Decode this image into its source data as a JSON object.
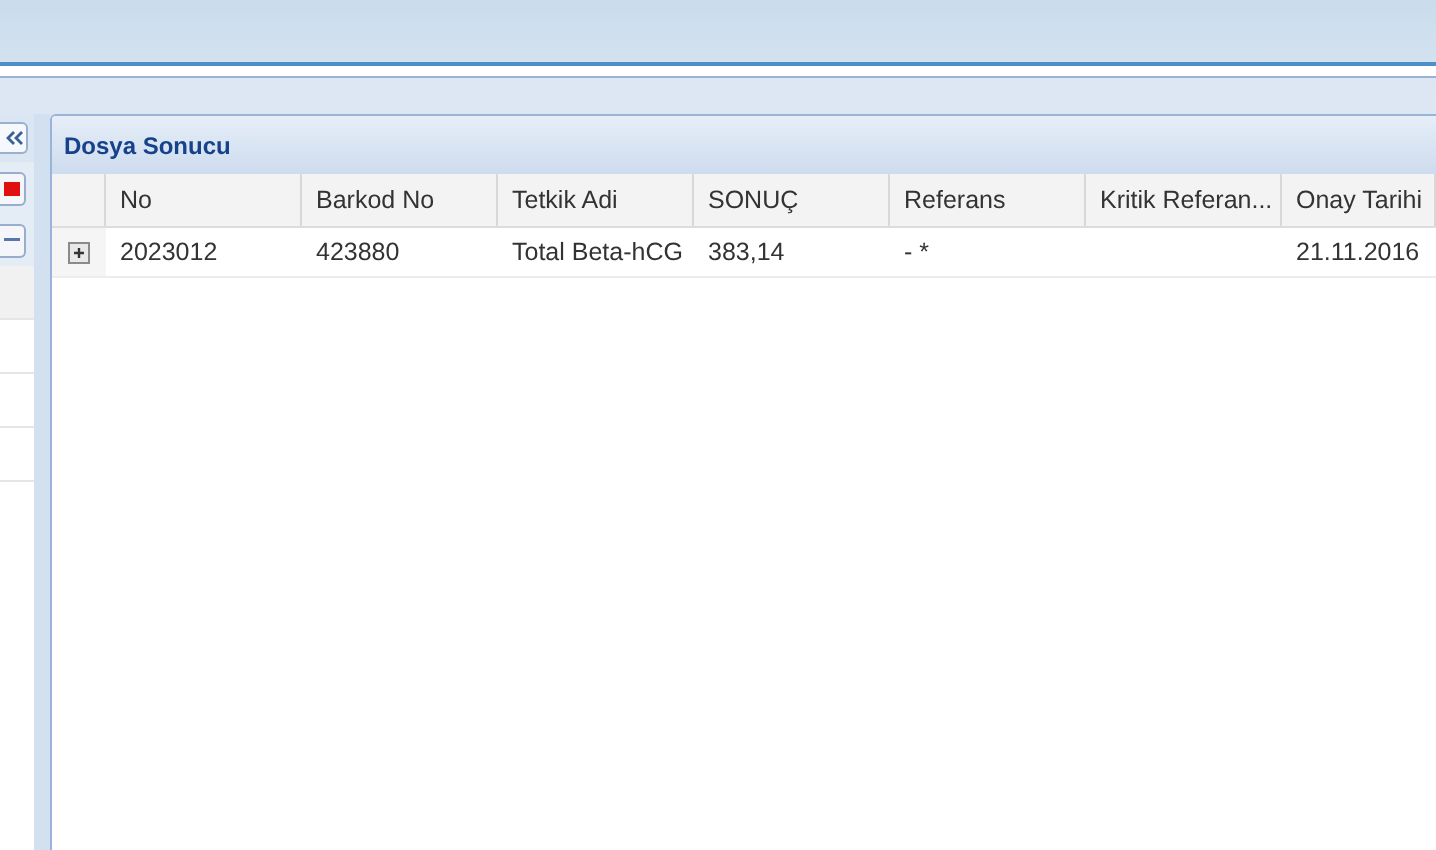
{
  "panel": {
    "title": "Dosya Sonucu"
  },
  "table": {
    "columns": [
      "No",
      "Barkod No",
      "Tetkik Adi",
      "SONUÇ",
      "Referans",
      "Kritik Referan...",
      "Onay Tarihi"
    ],
    "rows": [
      {
        "expanded": false,
        "cells": [
          "2023012",
          "423880",
          "Total Beta-hCG",
          "383,14",
          "- *",
          "",
          "21.11.2016"
        ]
      }
    ]
  }
}
